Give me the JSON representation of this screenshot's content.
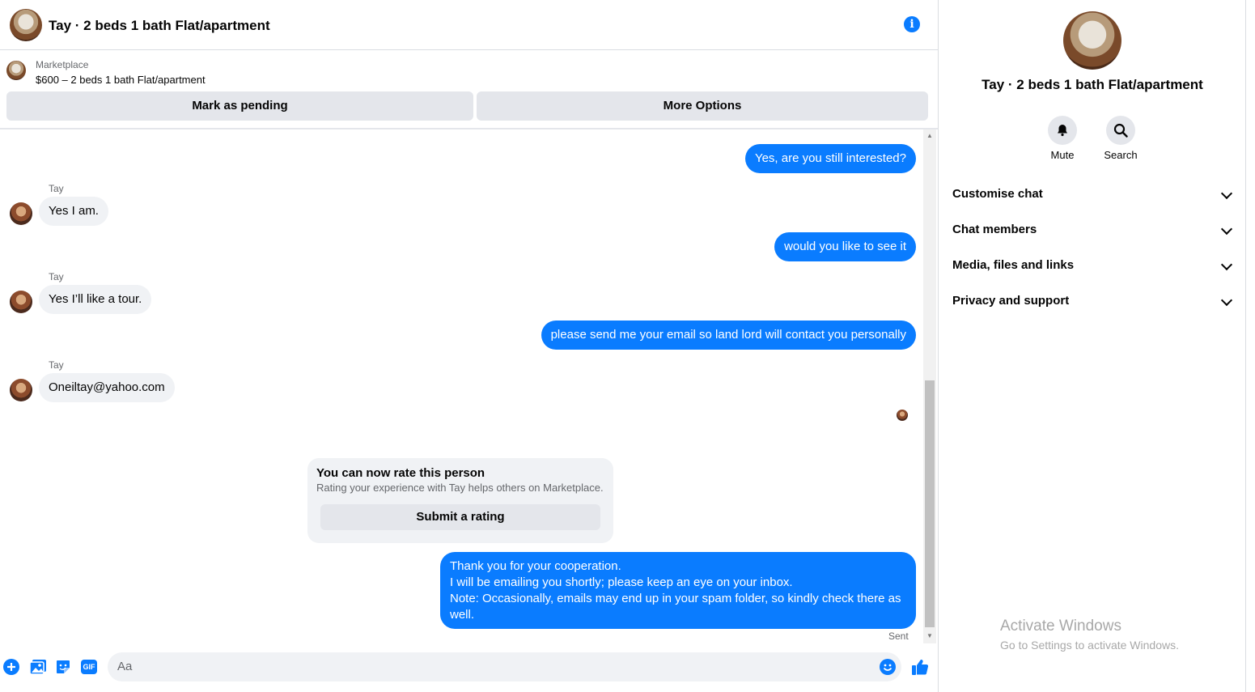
{
  "header": {
    "title": "Tay · 2 beds 1 bath Flat/apartment",
    "info_icon": "i"
  },
  "listing": {
    "source": "Marketplace",
    "summary": "$600 – 2 beds 1 bath Flat/apartment"
  },
  "actions": {
    "mark_pending": "Mark as pending",
    "more_options": "More Options"
  },
  "messages": [
    {
      "dir": "out",
      "text": "Yes, are you still interested?"
    },
    {
      "dir": "in",
      "sender": "Tay",
      "text": "Yes I am."
    },
    {
      "dir": "out",
      "text": "would you like to see it"
    },
    {
      "dir": "in",
      "sender": "Tay",
      "text": "Yes I’ll like a tour."
    },
    {
      "dir": "out",
      "text": "please send me your email so land lord will contact you personally"
    },
    {
      "dir": "in",
      "sender": "Tay",
      "text": "Oneiltay@yahoo.com"
    }
  ],
  "rating": {
    "title": "You can now rate this person",
    "subtitle": "Rating your experience with Tay helps others on Marketplace.",
    "button": "Submit a rating"
  },
  "final_message": {
    "line1": "Thank you for your cooperation.",
    "line2": "I will be emailing you shortly; please keep an eye on your inbox.",
    "line3": "Note: Occasionally, emails may end up in your spam folder, so kindly check there as well."
  },
  "sent_label": "Sent",
  "composer": {
    "placeholder": "Aa",
    "gif_label": "GIF"
  },
  "panel": {
    "title": "Tay · 2 beds 1 bath Flat/apartment",
    "mute": "Mute",
    "search": "Search",
    "sections": [
      "Customise chat",
      "Chat members",
      "Media, files and links",
      "Privacy and support"
    ]
  },
  "watermark": {
    "line1": "Activate Windows",
    "line2": "Go to Settings to activate Windows."
  },
  "colors": {
    "accent": "#0a7cff",
    "bubble_in": "#f0f2f5",
    "button_gray": "#e4e6eb"
  }
}
